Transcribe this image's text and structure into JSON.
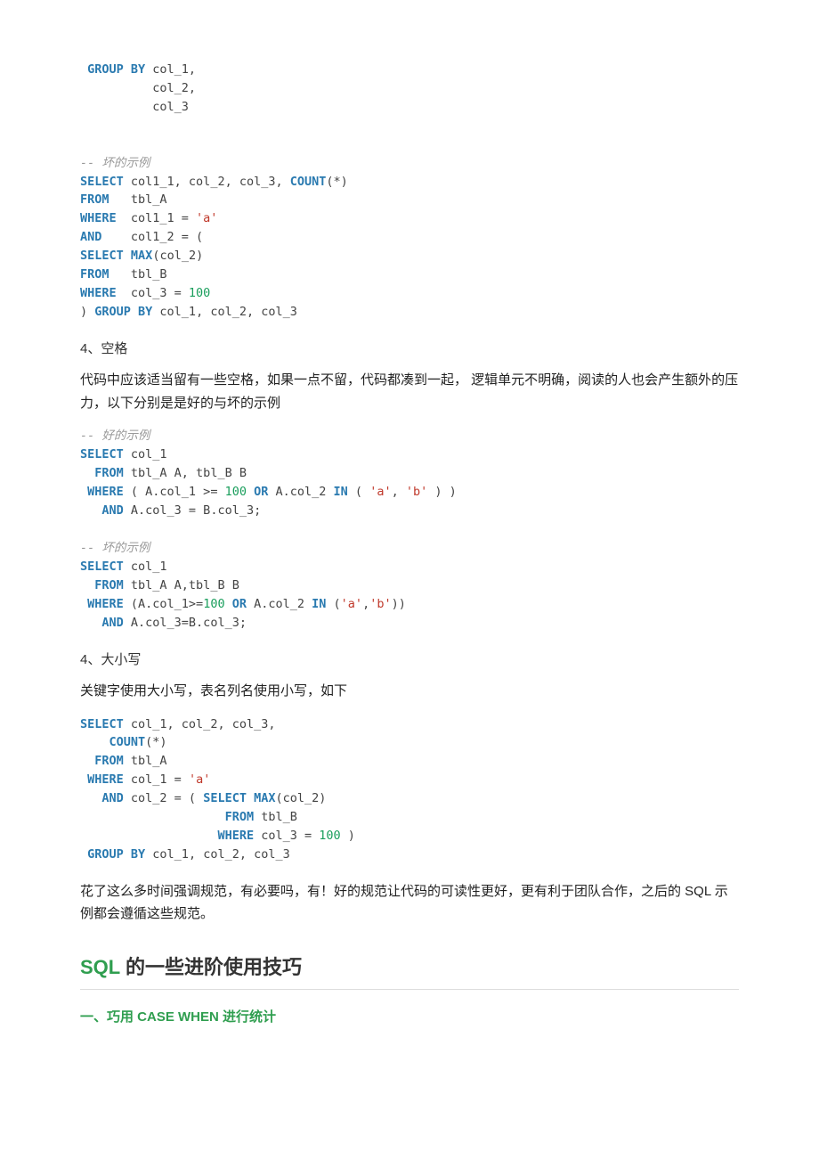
{
  "code1": {
    "l1": {
      "kw": " GROUP BY",
      "rest": " col_1,"
    },
    "l2": "          col_2,",
    "l3": "          col_3",
    "blank1": "",
    "blank2": "",
    "cmt1": "-- 坏的示例",
    "l4": {
      "kw": "SELECT",
      "rest": " col1_1, col_2, col_3, ",
      "kw2": "COUNT",
      "rest2": "(*)"
    },
    "l5": {
      "kw": "FROM",
      "rest": "   tbl_A"
    },
    "l6": {
      "kw": "WHERE",
      "rest": "  col1_1 = ",
      "str": "'a'"
    },
    "l7": {
      "kw": "AND",
      "rest": "    col1_2 = ("
    },
    "l8": {
      "kw1": "SELECT",
      "sp": " ",
      "kw2": "MAX",
      "rest": "(col_2)"
    },
    "l9": {
      "kw": "FROM",
      "rest": "   tbl_B"
    },
    "l10": {
      "kw": "WHERE",
      "rest": "  col_3 = ",
      "num": "100"
    },
    "l11": {
      "a": ") ",
      "kw": "GROUP BY",
      "rest": " col_1, col_2, col_3"
    }
  },
  "subhead1": "4、空格",
  "para1": "代码中应该适当留有一些空格，如果一点不留，代码都凑到一起， 逻辑单元不明确，阅读的人也会产生额外的压力，以下分别是是好的与坏的示例",
  "code2": {
    "cmt1": "-- 好的示例",
    "l1": {
      "kw": "SELECT",
      "rest": " col_1"
    },
    "l2": {
      "sp": "  ",
      "kw": "FROM",
      "rest": " tbl_A A, tbl_B B"
    },
    "l3": {
      "sp": " ",
      "kw": "WHERE",
      "rest1": " ( A.col_1 >= ",
      "num": "100",
      "sp2": " ",
      "kw2": "OR",
      "rest2": " A.col_2 ",
      "kw3": "IN",
      "rest3": " ( ",
      "str1": "'a'",
      "c": ", ",
      "str2": "'b'",
      "rest4": " ) )"
    },
    "l4": {
      "sp": "   ",
      "kw": "AND",
      "rest": " A.col_3 = B.col_3;"
    },
    "blank1": "",
    "cmt2": "-- 坏的示例",
    "l5": {
      "kw": "SELECT",
      "rest": " col_1"
    },
    "l6": {
      "sp": "  ",
      "kw": "FROM",
      "rest": " tbl_A A,tbl_B B"
    },
    "l7": {
      "sp": " ",
      "kw": "WHERE",
      "rest1": " (A.col_1>=",
      "num": "100",
      "sp2": " ",
      "kw2": "OR",
      "rest2": " A.col_2 ",
      "kw3": "IN",
      "rest3": " (",
      "str1": "'a'",
      "c": ",",
      "str2": "'b'",
      "rest4": "))"
    },
    "l8": {
      "sp": "   ",
      "kw": "AND",
      "rest": " A.col_3=B.col_3;"
    }
  },
  "subhead2": "4、大小写",
  "para2": "关键字使用大小写，表名列名使用小写，如下",
  "code3": {
    "l1": {
      "kw": "SELECT",
      "rest": " col_1, col_2, col_3,"
    },
    "l2": {
      "sp": "    ",
      "kw": "COUNT",
      "rest": "(*)"
    },
    "l3": {
      "sp": "  ",
      "kw": "FROM",
      "rest": " tbl_A"
    },
    "l4": {
      "sp": " ",
      "kw": "WHERE",
      "rest": " col_1 = ",
      "str": "'a'"
    },
    "l5": {
      "sp": "   ",
      "kw": "AND",
      "rest1": " col_2 = ( ",
      "kw2": "SELECT",
      "sp2": " ",
      "kw3": "MAX",
      "rest2": "(col_2)"
    },
    "l6": {
      "sp": "                    ",
      "kw": "FROM",
      "rest": " tbl_B"
    },
    "l7": {
      "sp": "                   ",
      "kw": "WHERE",
      "rest": " col_3 = ",
      "num": "100",
      "rest2": " )"
    },
    "l8": {
      "sp": " ",
      "kw": "GROUP BY",
      "rest": " col_1, col_2, col_3"
    }
  },
  "para3": "花了这么多时间强调规范，有必要吗，有！好的规范让代码的可读性更好，更有利于团队合作，之后的 SQL 示例都会遵循这些规范。",
  "heading2": {
    "accent": "SQL ",
    "rest": "的一些进阶使用技巧"
  },
  "subsection": "一、巧用 CASE WHEN 进行统计"
}
